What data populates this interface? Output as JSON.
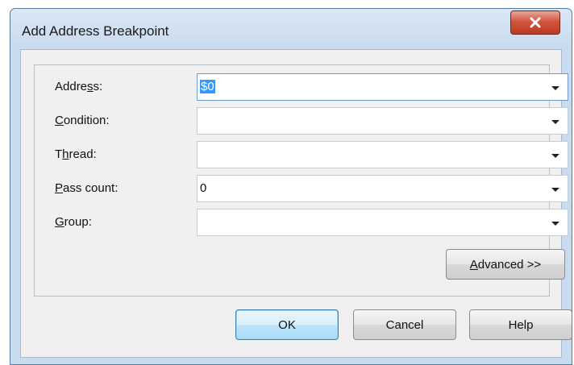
{
  "dialog": {
    "title": "Add Address Breakpoint",
    "close_icon": "close-x-icon"
  },
  "fields": [
    {
      "label": "Address:",
      "value": "$0",
      "selected": true
    },
    {
      "label": "Condition:",
      "value": ""
    },
    {
      "label": "Thread:",
      "value": ""
    },
    {
      "label": "Pass count:",
      "value": "0"
    },
    {
      "label": "Group:",
      "value": ""
    }
  ],
  "buttons": {
    "advanced": "Advanced >>",
    "ok": "OK",
    "cancel": "Cancel",
    "help": "Help"
  },
  "colors": {
    "close_button": "#c8452c",
    "selection": "#3399ff",
    "default_button_border": "#3c7fb1"
  }
}
